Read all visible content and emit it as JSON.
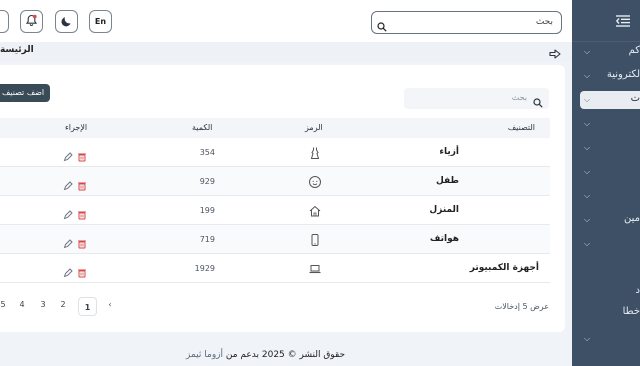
{
  "header": {
    "search_placeholder": "بحث",
    "lang_button": "En"
  },
  "breadcrumb": {
    "title": "الرئيسة"
  },
  "sidebar": {
    "items": [
      {
        "label": "كم",
        "active": false
      },
      {
        "label": "لكترونية",
        "active": false
      },
      {
        "label": "ت",
        "active": true
      },
      {
        "label": "",
        "active": false
      },
      {
        "label": "",
        "active": false
      },
      {
        "label": "",
        "active": false
      },
      {
        "label": "",
        "active": false
      },
      {
        "label": "مين",
        "active": false
      },
      {
        "label": "",
        "active": false
      },
      {
        "label": "د",
        "active": false
      },
      {
        "label": "خطا",
        "active": false
      },
      {
        "label": "",
        "active": false
      }
    ]
  },
  "card": {
    "add_button": "اضف تصنيف",
    "filter_placeholder": "بحث",
    "columns": {
      "category": "التصنيف",
      "icon": "الرمز",
      "quantity": "الكمية",
      "action": "الإجراء"
    },
    "rows": [
      {
        "name": "أزياء",
        "icon": "dress-icon",
        "quantity": "354"
      },
      {
        "name": "طفل",
        "icon": "baby-face-icon",
        "quantity": "929"
      },
      {
        "name": "المنزل",
        "icon": "home-icon",
        "quantity": "199"
      },
      {
        "name": "هواتف",
        "icon": "phone-icon",
        "quantity": "719"
      },
      {
        "name": "أجهزة الكمبيوتر",
        "icon": "laptop-icon",
        "quantity": "1929"
      }
    ],
    "pagination": {
      "entries_text": "عرض 5 إدخالات",
      "pages": [
        "1",
        "2",
        "3",
        "4",
        "5"
      ],
      "current": "1"
    }
  },
  "footer": {
    "text": "حقوق النشر © 2025 بدعم من",
    "brand": "أزوما ثيمز"
  },
  "colors": {
    "sidebar_bg": "#3d5066",
    "primary_button": "#3a4b58",
    "delete_icon": "#d64545",
    "edit_icon": "#6b7480"
  }
}
